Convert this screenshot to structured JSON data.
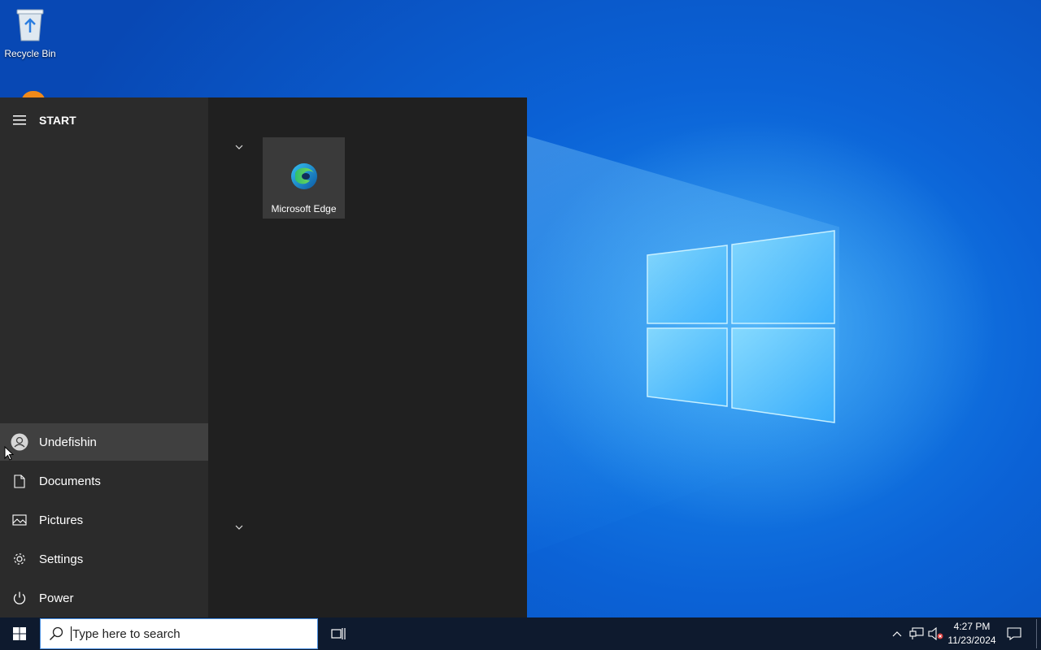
{
  "desktop": {
    "icons": [
      {
        "label": "Recycle Bin",
        "icon": "recycle-bin-icon"
      }
    ]
  },
  "start_menu": {
    "title": "START",
    "user": {
      "label": "Undefishin",
      "icon": "user-avatar-icon"
    },
    "items": [
      {
        "label": "Documents",
        "icon": "document-icon"
      },
      {
        "label": "Pictures",
        "icon": "pictures-icon"
      },
      {
        "label": "Settings",
        "icon": "gear-icon"
      },
      {
        "label": "Power",
        "icon": "power-icon"
      }
    ],
    "tiles": [
      {
        "label": "Microsoft Edge",
        "icon": "edge-icon"
      }
    ]
  },
  "taskbar": {
    "search_placeholder": "Type here to search",
    "time": "4:27 PM",
    "date": "11/23/2024"
  },
  "colors": {
    "start_left_bg": "#2b2b2b",
    "start_right_bg": "#202020",
    "taskbar_bg": "#0e1a2e",
    "desktop_blue": "#0b62d6"
  }
}
